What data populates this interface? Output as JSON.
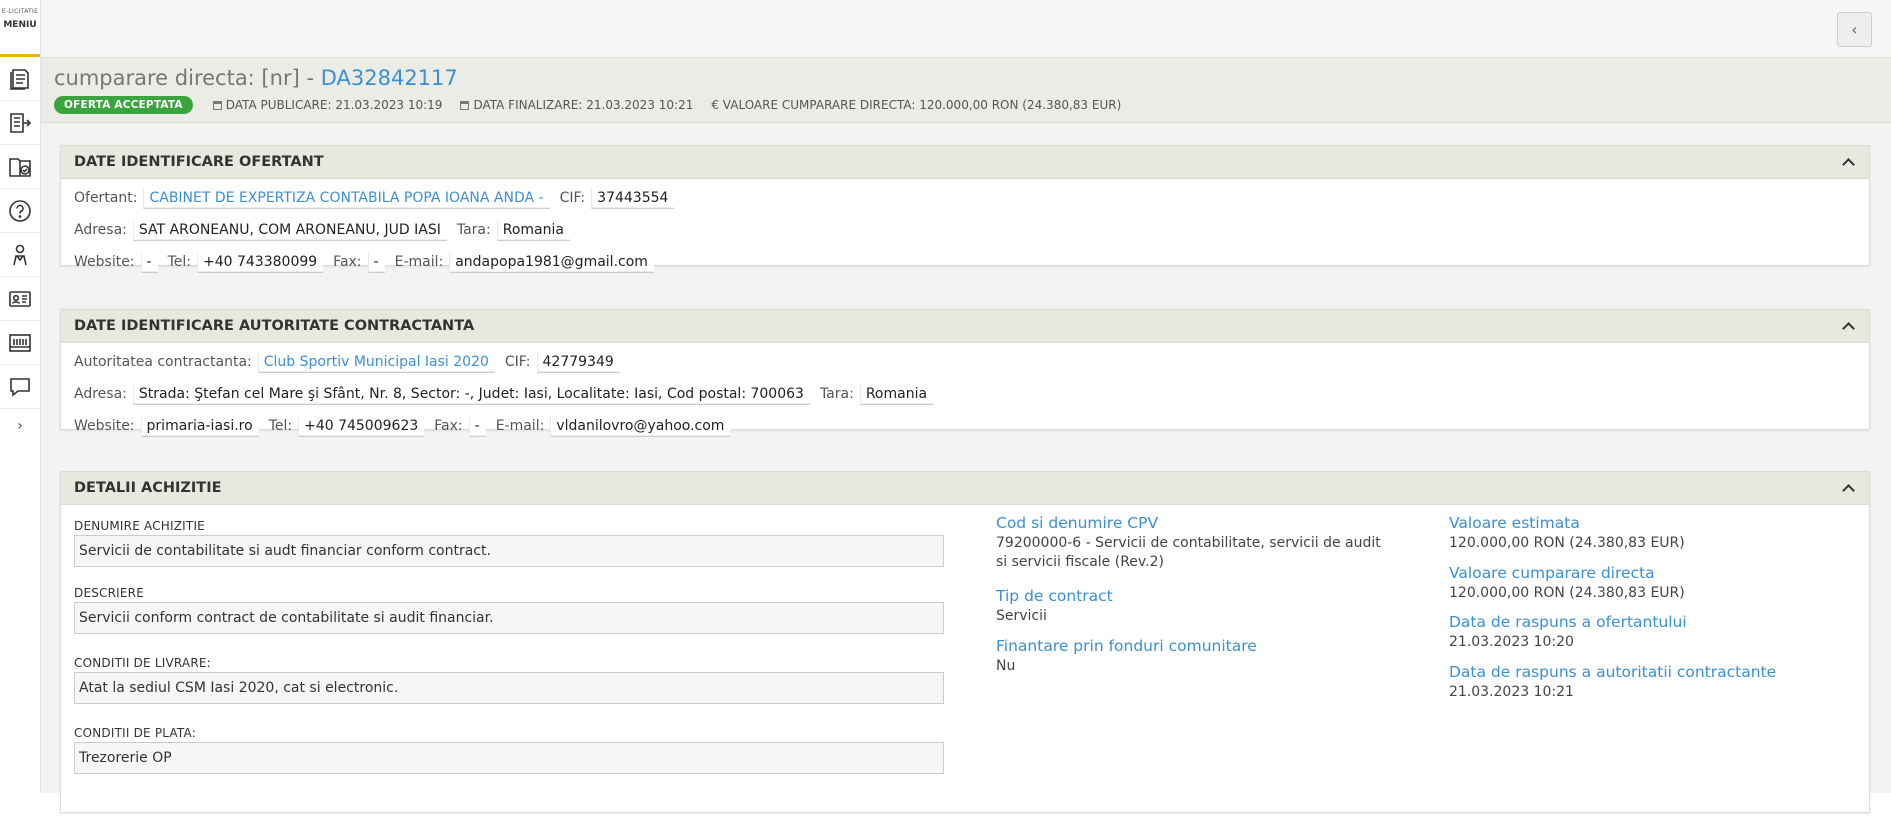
{
  "sidebar": {
    "brand_small": "E-LICITATIE",
    "menu_label": "MENIU",
    "items": [
      {
        "icon": "document-icon"
      },
      {
        "icon": "list-arrow-icon"
      },
      {
        "icon": "book-check-icon"
      },
      {
        "icon": "help-icon"
      },
      {
        "icon": "user-support-icon"
      },
      {
        "icon": "id-card-icon"
      },
      {
        "icon": "catalog-icon"
      },
      {
        "icon": "chat-icon"
      }
    ],
    "expand_label": "›"
  },
  "topbar": {
    "collapse_label": "‹"
  },
  "header": {
    "title_prefix": "cumparare directa: [nr] - ",
    "title_code": "DA32842117",
    "status_badge": "OFERTA ACCEPTATA",
    "data_publicare": "DATA PUBLICARE: 21.03.2023 10:19",
    "data_finalizare": "DATA FINALIZARE: 21.03.2023 10:21",
    "valoare": "€ VALOARE CUMPARARE DIRECTA: 120.000,00  RON (24.380,83  EUR)"
  },
  "ofertant": {
    "title": "DATE IDENTIFICARE OFERTANT",
    "ofertant_label": "Ofertant:",
    "ofertant_value": "CABINET DE EXPERTIZA CONTABILA POPA IOANA ANDA -",
    "cif_label": "CIF:",
    "cif_value": "37443554",
    "adresa_label": "Adresa:",
    "adresa_value": "SAT ARONEANU, COM ARONEANU, JUD IASI",
    "tara_label": "Tara:",
    "tara_value": "Romania",
    "website_label": "Website:",
    "website_value": "-",
    "tel_label": "Tel:",
    "tel_value": "+40 743380099",
    "fax_label": "Fax:",
    "fax_value": "-",
    "email_label": "E-mail:",
    "email_value": "andapopa1981@gmail.com"
  },
  "autoritate": {
    "title": "DATE IDENTIFICARE AUTORITATE CONTRACTANTA",
    "autoritate_label": "Autoritatea contractanta:",
    "autoritate_value": "Club Sportiv Municipal Iasi 2020",
    "cif_label": "CIF:",
    "cif_value": "42779349",
    "adresa_label": "Adresa:",
    "adresa_value": "Strada: Ştefan cel Mare şi Sfânt, Nr. 8, Sector: -, Judet: Iasi, Localitate: Iasi, Cod postal: 700063",
    "tara_label": "Tara:",
    "tara_value": "Romania",
    "website_label": "Website:",
    "website_value": "primaria-iasi.ro",
    "tel_label": "Tel:",
    "tel_value": "+40 745009623",
    "fax_label": "Fax:",
    "fax_value": "-",
    "email_label": "E-mail:",
    "email_value": "vldanilovro@yahoo.com"
  },
  "detalii": {
    "title": "DETALII ACHIZITIE",
    "denumire_label": "DENUMIRE ACHIZITIE",
    "denumire_value": "Servicii de contabilitate si audt financiar conform contract.",
    "descriere_label": "DESCRIERE",
    "descriere_value": "Servicii conform contract de contabilitate si audit financiar.",
    "livrare_label": "CONDITII DE LIVRARE:",
    "livrare_value": "Atat la sediul CSM Iasi 2020, cat si electronic.",
    "plata_label": "CONDITII DE PLATA:",
    "plata_value": "Trezorerie OP",
    "cpv_label": "Cod si denumire CPV",
    "cpv_value": "79200000-6 - Servicii de contabilitate, servicii de audit si servicii fiscale (Rev.2)",
    "tip_label": "Tip de contract",
    "tip_value": "Servicii",
    "fonduri_label": "Finantare prin fonduri comunitare",
    "fonduri_value": "Nu",
    "val_est_label": "Valoare estimata",
    "val_est_value": "120.000,00  RON (24.380,83  EUR)",
    "val_cd_label": "Valoare cumparare directa",
    "val_cd_value": "120.000,00  RON (24.380,83  EUR)",
    "rasp_of_label": "Data de raspuns a ofertantului",
    "rasp_of_value": "21.03.2023 10:20",
    "rasp_aut_label": "Data de raspuns a autoritatii contractante",
    "rasp_aut_value": "21.03.2023 10:21"
  }
}
